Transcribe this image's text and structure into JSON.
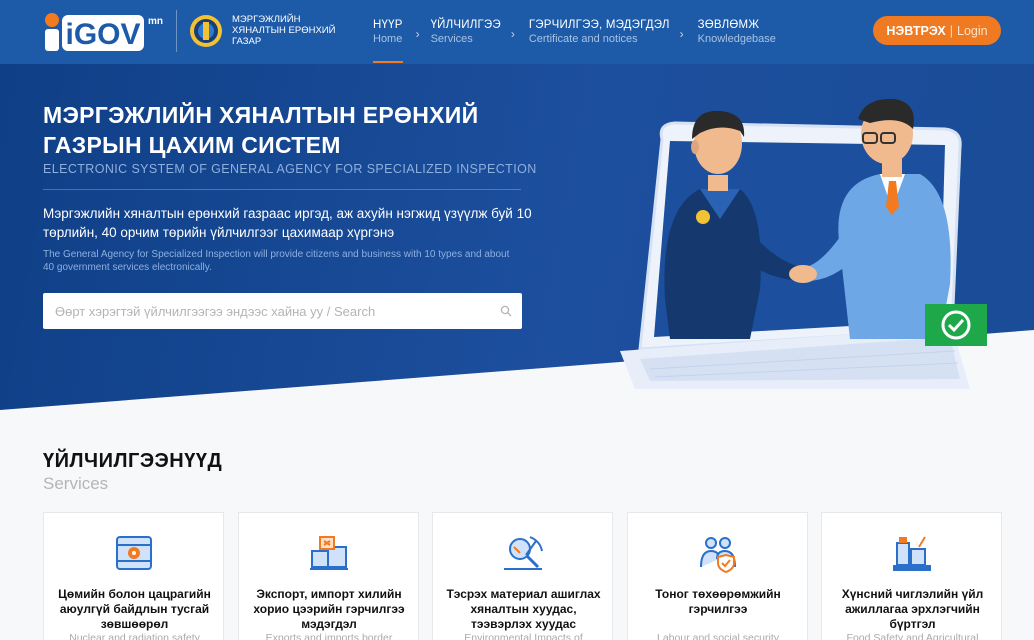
{
  "header": {
    "logo_text": "iGOV",
    "logo_suffix": "mn",
    "agency_name": "МЭРГЭЖЛИЙН ХЯНАЛТЫН ЕРӨНХИЙ ГАЗАР",
    "nav": [
      {
        "mn": "НҮҮР",
        "en": "Home",
        "active": true
      },
      {
        "mn": "ҮЙЛЧИЛГЭЭ",
        "en": "Services"
      },
      {
        "mn": "ГЭРЧИЛГЭЭ, МЭДЭГДЭЛ",
        "en": "Certificate and notices"
      },
      {
        "mn": "ЗӨВЛӨМЖ",
        "en": "Knowledgebase"
      }
    ],
    "login": {
      "mn": "НЭВТРЭХ",
      "separator": "|",
      "en": "Login"
    }
  },
  "hero": {
    "title": "МЭРГЭЖЛИЙН ХЯНАЛТЫН ЕРӨНХИЙ ГАЗРЫН ЦАХИМ СИСТЕМ",
    "subtitle": "ELECTRONIC SYSTEM OF GENERAL AGENCY FOR SPECIALIZED INSPECTION",
    "description": "Мэргэжлийн хяналтын ерөнхий газраас иргэд, аж ахуйн нэгжид үзүүлж буй 10 төрлийн, 40 орчим төрийн үйлчилгээг цахимаар хүргэнэ",
    "description_en": "The General Agency for Specialized Inspection will provide citizens and business with 10 types and about 40 government services electronically.",
    "search_placeholder": "Өөрт хэрэгтэй үйлчилгээгээ эндээс хайна уу / Search"
  },
  "services": {
    "heading": "ҮЙЛЧИЛГЭЭНҮҮД",
    "subheading": "Services",
    "cards": [
      {
        "title": "Цөмийн болон цацрагийн аюулгүй байдлын тусгай зөвшөөрөл",
        "subtitle": "Nuclear and radiation safety",
        "icon": "radiation-barrel-icon"
      },
      {
        "title": "Экспорт, импорт хилийн хорио цээрийн гэрчилгээ мэдэгдэл",
        "subtitle": "Exports and imports border",
        "icon": "boxes-icon"
      },
      {
        "title": "Тэсрэх материал ашиглах хяналтын хуудас, тээвэрлэх хуудас",
        "subtitle": "Environmental Impacts of",
        "icon": "mining-tools-icon"
      },
      {
        "title": "Тоног төхөөрөмжийн гэрчилгээ",
        "subtitle": "Labour and social security inspection",
        "icon": "workers-shield-icon"
      },
      {
        "title": "Хүнсний чиглэлийн үйл ажиллагаа эрхлэгчийн бүртгэл",
        "subtitle": "Food Safety and Agricultural",
        "icon": "food-products-icon"
      }
    ]
  },
  "colors": {
    "header_bg": "#1d5ba8",
    "hero_bg": "#1c4f9e",
    "accent": "#f07a22",
    "icon_blue": "#2a6fc9"
  }
}
